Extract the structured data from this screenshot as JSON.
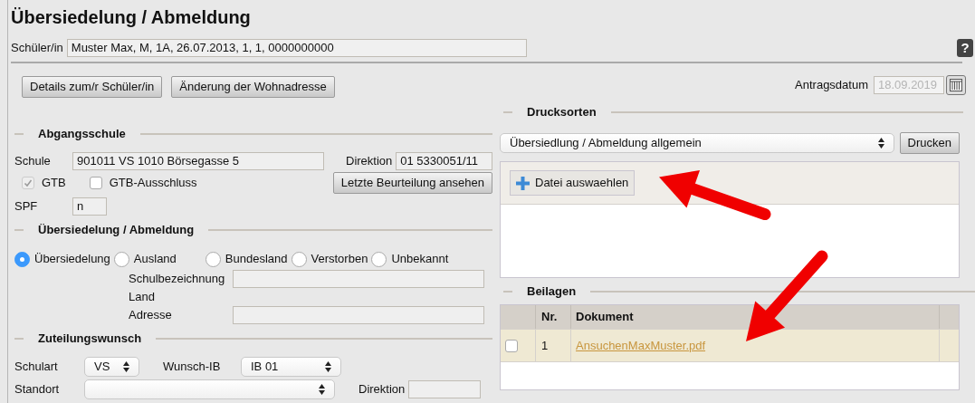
{
  "title": "Übersiedelung / Abmeldung",
  "student": {
    "label": "Schüler/in",
    "value": "Muster Max, M, 1A, 26.07.2013, 1, 1, 0000000000"
  },
  "help": {
    "label": "?"
  },
  "buttons": [
    "Details zum/r Schüler/in",
    "Änderung der Wohnadresse"
  ],
  "application_date": {
    "label": "Antragsdatum",
    "value": "18.09.2019",
    "disabled": true
  },
  "leaving_school": {
    "heading": "Abgangsschule",
    "school_label": "Schule",
    "school_value": "901011 VS 1010 Börsegasse 5",
    "directorate_label": "Direktion",
    "directorate_value": "01 5330051/11",
    "checkboxes": [
      {
        "label": "GTB",
        "checked": true,
        "disabled": true
      },
      {
        "label": "GTB-Ausschluss",
        "checked": false,
        "disabled": false
      }
    ],
    "report_button": "Letzte Beurteilung ansehen",
    "spf_label": "SPF",
    "spf_value": "n"
  },
  "transfer": {
    "heading": "Übersiedelung / Abmeldung",
    "options": [
      {
        "label": "Übersiedelung",
        "selected": true
      },
      {
        "label": "Ausland",
        "selected": false
      },
      {
        "label": "Bundesland",
        "selected": false
      },
      {
        "label": "Verstorben",
        "selected": false
      },
      {
        "label": "Unbekannt",
        "selected": false
      }
    ],
    "fields": [
      {
        "label": "Schulbezeichnung",
        "kind": "input"
      },
      {
        "label": "Land",
        "kind": "text"
      },
      {
        "label": "Adresse",
        "kind": "input"
      }
    ]
  },
  "assignment": {
    "heading": "Zuteilungswunsch",
    "school_type_label": "Schulart",
    "school_type": "VS",
    "wish_label": "Wunsch-IB",
    "wish": "IB 01",
    "location_label": "Standort",
    "directorate_label": "Direktion"
  },
  "print_forms": {
    "heading": "Drucksorten",
    "selected": "Übersiedlung / Abmeldung allgemein",
    "print_button": "Drucken",
    "file_button": "Datei auswaehlen"
  },
  "attachments": {
    "heading": "Beilagen",
    "columns": [
      "Nr.",
      "Dokument"
    ],
    "rows": [
      {
        "checked": false,
        "nr": "1",
        "document": "AnsuchenMaxMuster.pdf",
        "selected": true
      }
    ]
  }
}
